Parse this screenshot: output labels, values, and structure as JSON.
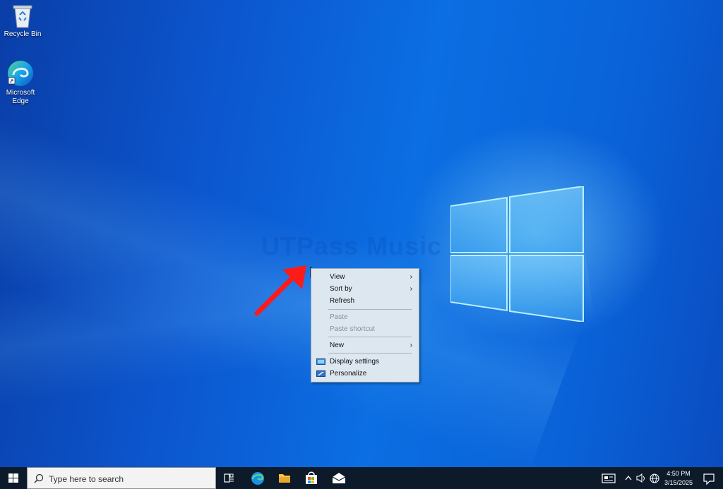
{
  "desktop": {
    "icons": [
      {
        "label": "Recycle Bin",
        "icon": "recycle-bin-icon"
      },
      {
        "label": "Microsoft Edge",
        "icon": "edge-icon"
      }
    ],
    "watermark": "UTPass Music"
  },
  "context_menu": {
    "items": [
      {
        "label": "View",
        "has_submenu": true
      },
      {
        "label": "Sort by",
        "has_submenu": true
      },
      {
        "label": "Refresh"
      },
      {
        "label": "Paste",
        "disabled": true
      },
      {
        "label": "Paste shortcut",
        "disabled": true
      },
      {
        "label": "New",
        "has_submenu": true
      },
      {
        "label": "Display settings",
        "icon": "display-settings-icon"
      },
      {
        "label": "Personalize",
        "icon": "personalize-icon"
      }
    ],
    "submenu_arrow": "›"
  },
  "annotation": {
    "arrow_color": "#ff1a1a"
  },
  "taskbar": {
    "search_placeholder": "Type here to search",
    "pinned": [
      "task-view-icon",
      "edge-icon",
      "file-explorer-icon",
      "store-icon",
      "mail-icon"
    ],
    "tray": [
      "news-icon",
      "chevron-up-icon",
      "volume-icon",
      "network-icon"
    ],
    "clock": {
      "time": "4:50 PM",
      "date": "3/15/2025"
    }
  }
}
